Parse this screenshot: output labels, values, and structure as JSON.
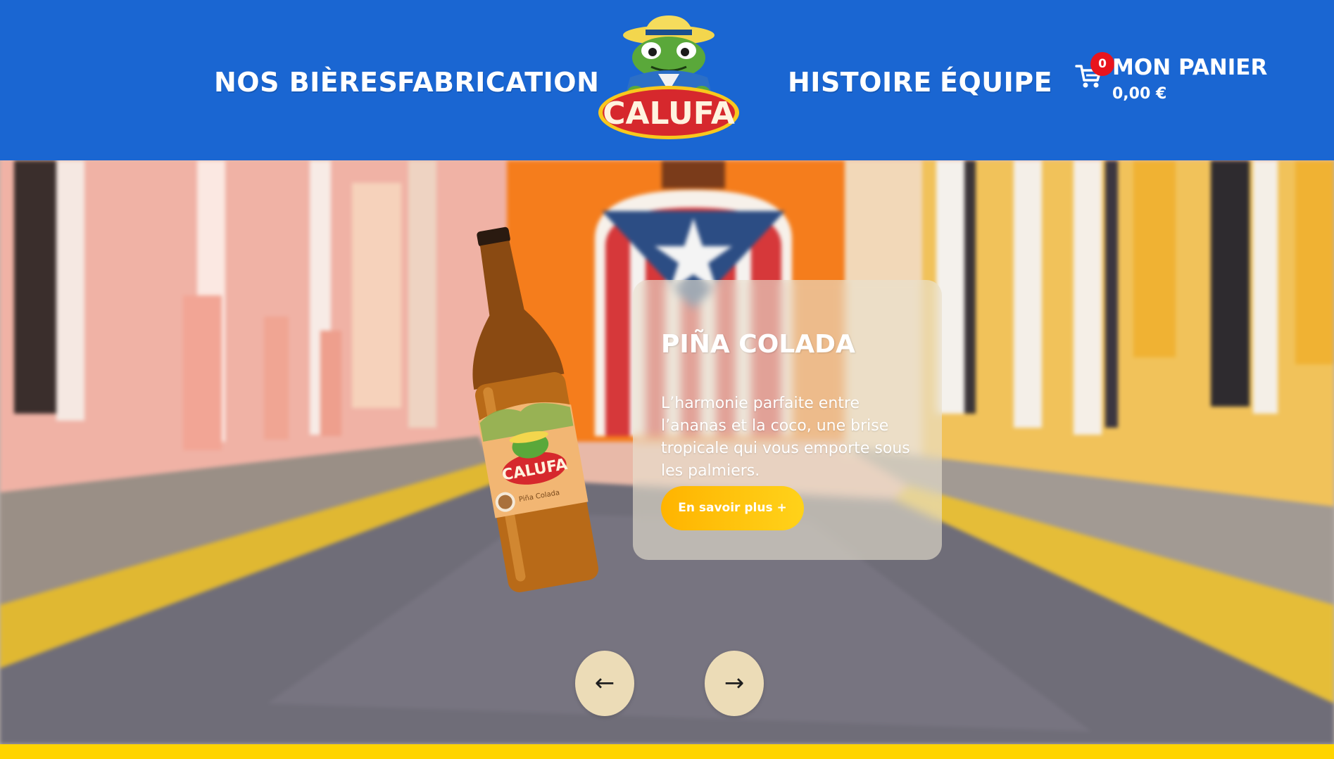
{
  "header": {
    "nav_left": [
      "NOS BIÈRES",
      "FABRICATION"
    ],
    "nav_right": [
      "HISTOIRE",
      "ÉQUIPE"
    ],
    "logo_text": "CALUFA",
    "cart": {
      "icon": "cart-icon",
      "count": "0",
      "label": "MON PANIER",
      "total": "0,00 €"
    }
  },
  "product": {
    "name": "PIÑA COLADA",
    "description": "L’harmonie parfaite entre l’ananas et la coco, une brise tropicale qui vous emporte sous les palmiers.",
    "cta": "En savoir plus +",
    "bottle_label_brand": "CALUFA",
    "bottle_label_flavor": "Piña Colada"
  },
  "carousel": {
    "prev": "←",
    "next": "→"
  },
  "colors": {
    "header_blue": "#1a66d2",
    "cta_yellow": "#ffc107",
    "badge_red": "#e8141d",
    "strip_yellow": "#ffd400"
  }
}
